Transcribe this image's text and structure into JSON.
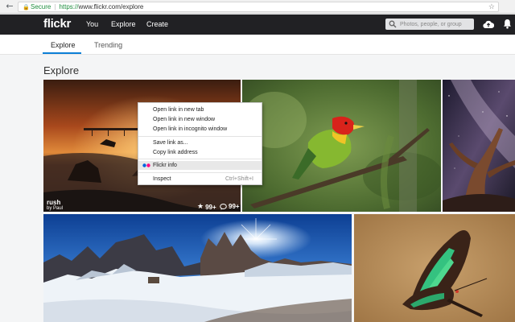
{
  "browser": {
    "security_label": "Secure",
    "url_protocol": "https://",
    "url_rest": "www.flickr.com/explore"
  },
  "header": {
    "logo": "flickr",
    "nav": [
      "You",
      "Explore",
      "Create"
    ],
    "search_placeholder": "Photos, people, or group"
  },
  "subnav": {
    "tabs": [
      "Explore",
      "Trending"
    ],
    "active_tab": "Explore"
  },
  "page": {
    "title": "Explore"
  },
  "photos": [
    {
      "title": "rush",
      "author": "by Paul",
      "favorites": "99+",
      "comments": "99+"
    }
  ],
  "context_menu": {
    "items": [
      "Open link in new tab",
      "Open link in new window",
      "Open link in incognito window",
      "Save link as...",
      "Copy link address",
      "Flickr info",
      "Inspect"
    ],
    "inspect_shortcut": "Ctrl+Shift+I"
  },
  "colors": {
    "header_bg": "#212124",
    "accent": "#0c7fd6",
    "flickr_pink": "#ff0084",
    "flickr_blue": "#0063dc"
  }
}
